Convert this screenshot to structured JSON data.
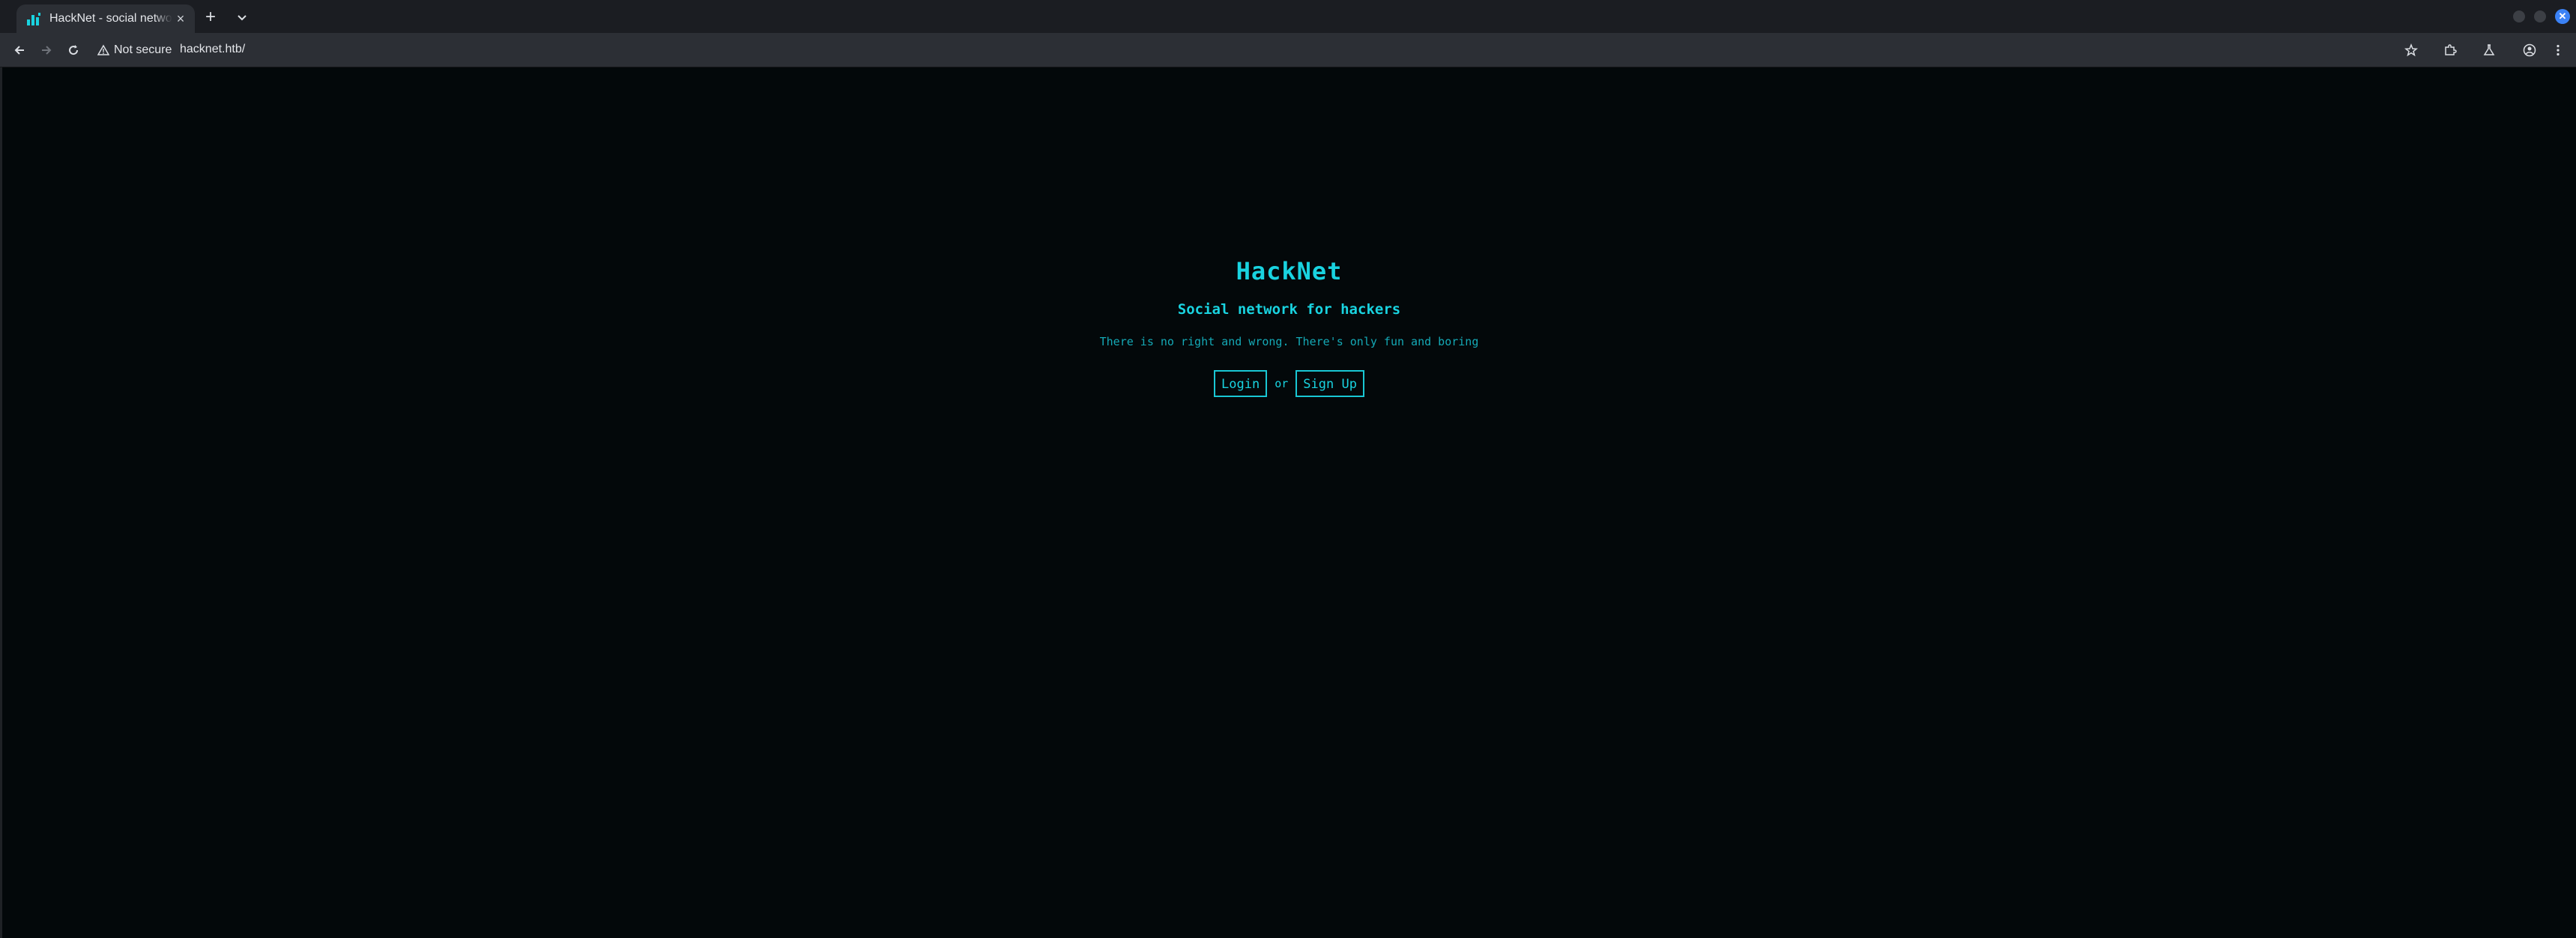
{
  "browser": {
    "tab": {
      "title": "HackNet - social network for hackers",
      "favicon": "bar-chart-icon",
      "close_label": "×"
    },
    "new_tab_label": "+",
    "toolbar": {
      "security_label": "Not secure",
      "url": "hacknet.htb/"
    }
  },
  "page": {
    "title": "HackNet",
    "subtitle": "Social network for hackers",
    "tagline": "There is no right and wrong. There's only fun and boring",
    "login_label": "Login",
    "or_label": "or",
    "signup_label": "Sign Up"
  },
  "colors": {
    "accent": "#19d3e0",
    "background": "#03080a",
    "chrome": "#2c2f35"
  }
}
